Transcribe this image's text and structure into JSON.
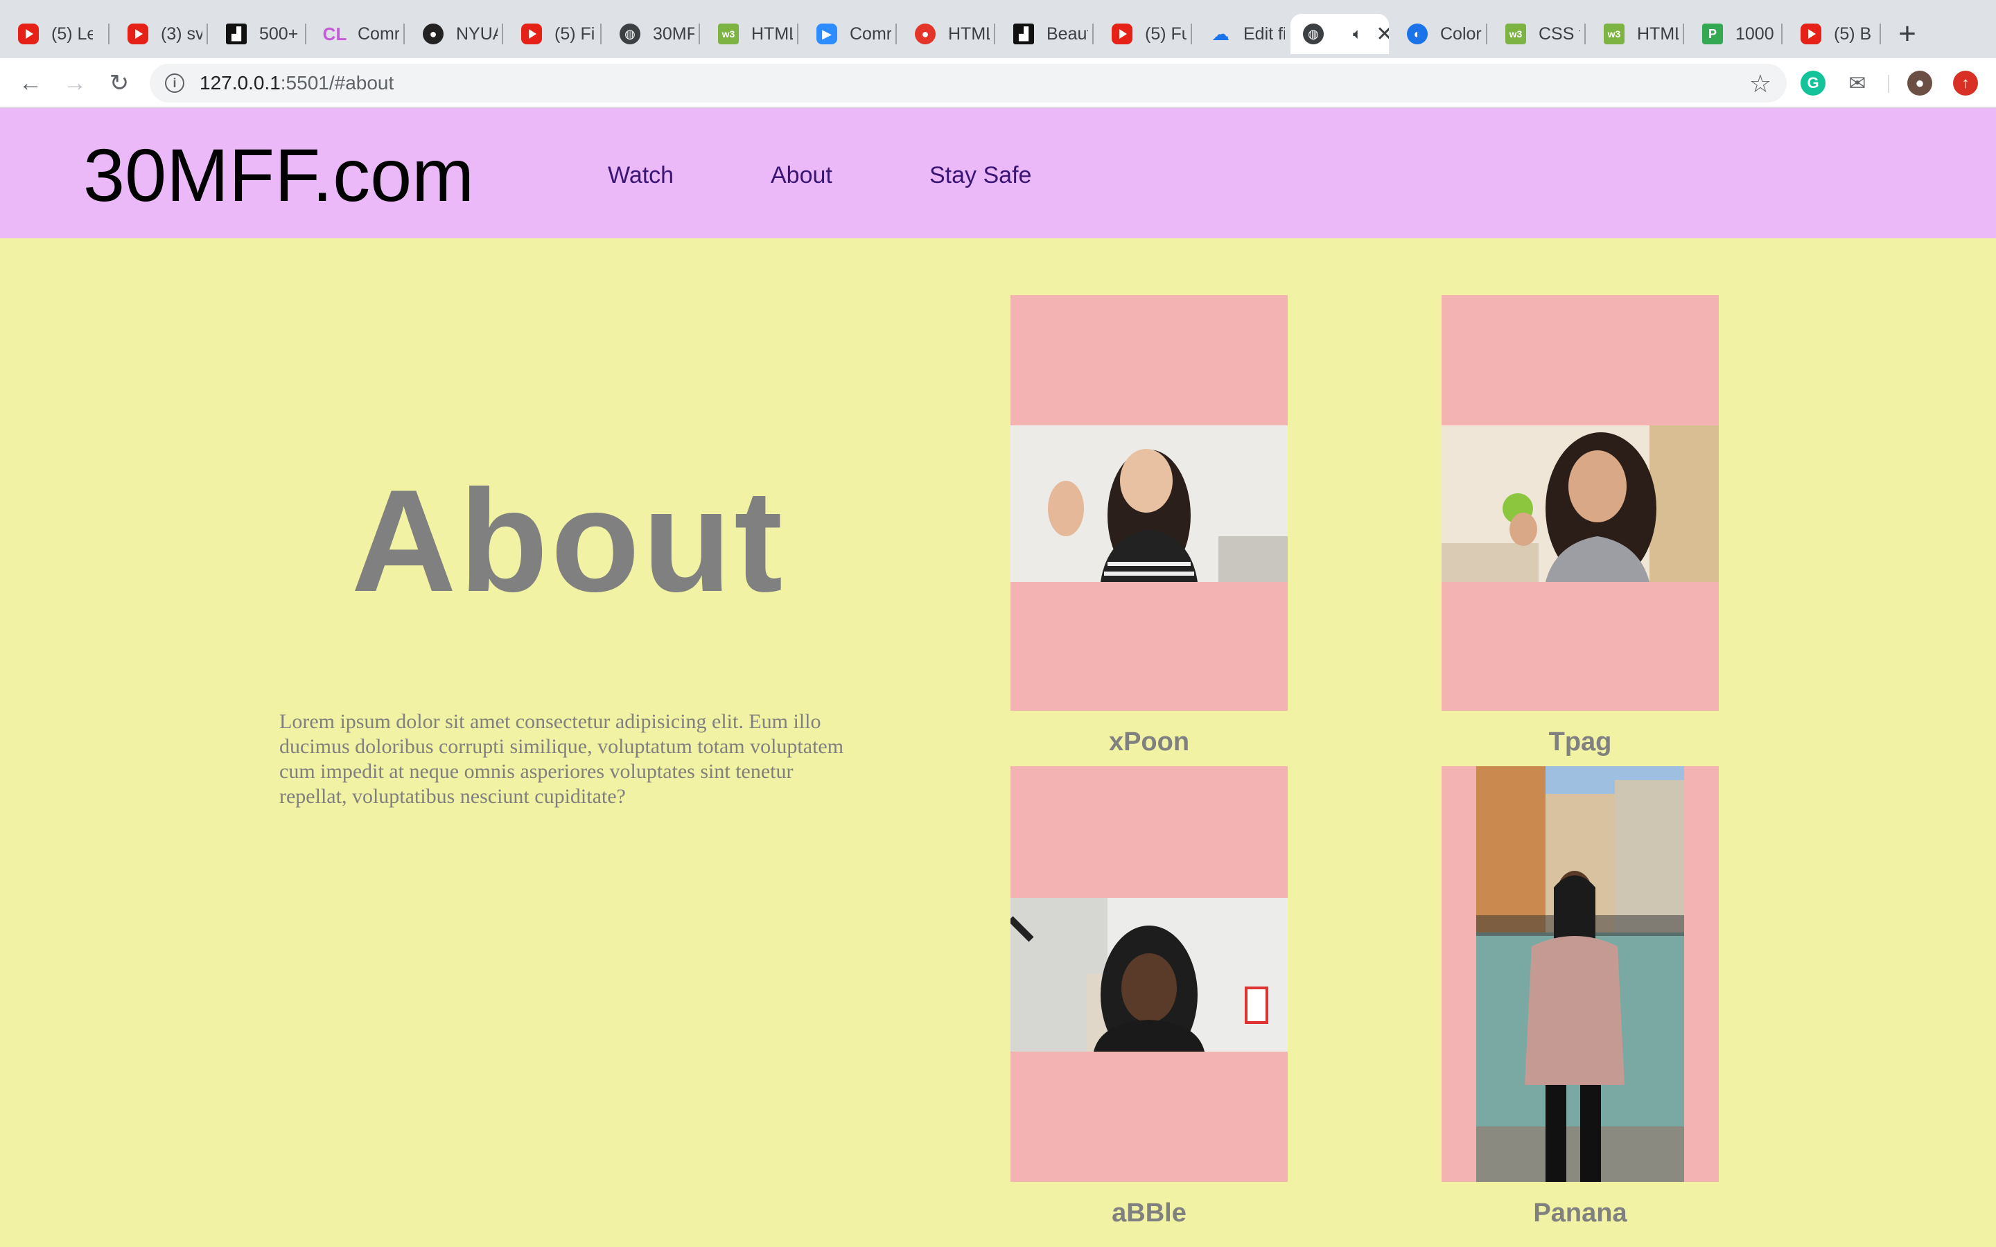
{
  "browser": {
    "tabs": [
      {
        "icon": "youtube-icon",
        "title": "(5) Le"
      },
      {
        "icon": "youtube-icon",
        "title": "(3) sv"
      },
      {
        "icon": "unsplash-icon",
        "title": "500+"
      },
      {
        "icon": "cl-icon",
        "title": "Comr"
      },
      {
        "icon": "github-icon",
        "title": "NYUA"
      },
      {
        "icon": "youtube-icon",
        "title": "(5) Fi"
      },
      {
        "icon": "globe-icon",
        "title": "30MF"
      },
      {
        "icon": "w3schools-icon",
        "title": "HTML"
      },
      {
        "icon": "zoom-icon",
        "title": "Comr"
      },
      {
        "icon": "record-icon",
        "title": "HTML"
      },
      {
        "icon": "unsplash-icon",
        "title": "Beaut"
      },
      {
        "icon": "youtube-icon",
        "title": "(5) Fu"
      },
      {
        "icon": "cloud-icon",
        "title": "Edit fi"
      },
      {
        "icon": "globe-icon",
        "title": "",
        "active": true
      },
      {
        "icon": "color-icon",
        "title": "Color"
      },
      {
        "icon": "w3schools-icon",
        "title": "CSS t"
      },
      {
        "icon": "w3schools-icon",
        "title": "HTML"
      },
      {
        "icon": "p-icon",
        "title": "1000"
      },
      {
        "icon": "youtube-icon",
        "title": "(5) B"
      }
    ],
    "url_host": "127.0.0.1",
    "url_rest": ":5501/#about"
  },
  "site": {
    "logo": "30MFF.com",
    "nav": {
      "watch": "Watch",
      "about": "About",
      "safe": "Stay Safe"
    },
    "about_title": "About",
    "about_text": "Lorem ipsum dolor sit amet consectetur adipisicing elit. Eum illo ducimus doloribus corrupti similique, voluptatum totam voluptatem cum impedit at neque omnis asperiores voluptates sint tenetur repellat, voluptatibus nesciunt cupiditate?",
    "cards": [
      {
        "name": "xPoon"
      },
      {
        "name": "Tpag"
      },
      {
        "name": "aBBle"
      },
      {
        "name": "Panana"
      }
    ]
  },
  "colors": {
    "page_bg": "#f1f2a3",
    "header_bg": "#ebb9f7",
    "card_bg": "#f4b3b3",
    "nav_link": "#3a1574",
    "muted_text": "#808080"
  }
}
